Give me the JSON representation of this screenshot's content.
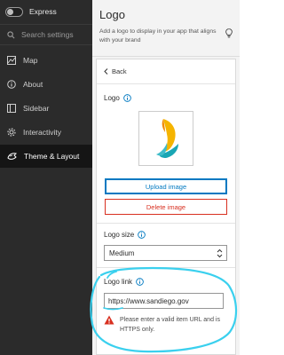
{
  "sidebar": {
    "toggle_label": "Express",
    "search_placeholder": "Search settings",
    "items": [
      {
        "label": "Map",
        "icon": "map-icon"
      },
      {
        "label": "About",
        "icon": "info-icon"
      },
      {
        "label": "Sidebar",
        "icon": "sidebar-icon"
      },
      {
        "label": "Interactivity",
        "icon": "gear-icon"
      },
      {
        "label": "Theme & Layout",
        "icon": "palette-icon",
        "active": true
      }
    ]
  },
  "panel": {
    "title": "Logo",
    "description": "Add a logo to display in your app that aligns with your brand",
    "back_label": "Back",
    "logo_label": "Logo",
    "upload_label": "Upload image",
    "delete_label": "Delete image",
    "logo_size_label": "Logo size",
    "logo_size_value": "Medium",
    "logo_link_label": "Logo link",
    "logo_link_value": "https://www.sandiego.gov",
    "error_message": "Please enter a valid item URL and is HTTPS only."
  },
  "colors": {
    "sidebar_bg": "#2b2b2b",
    "active_bg": "#151515",
    "accent_blue": "#0079c1",
    "danger_red": "#d83020",
    "highlight_cyan": "#3ad0ee",
    "logo_yellow": "#f5b400",
    "logo_teal": "#1aa6b4"
  }
}
